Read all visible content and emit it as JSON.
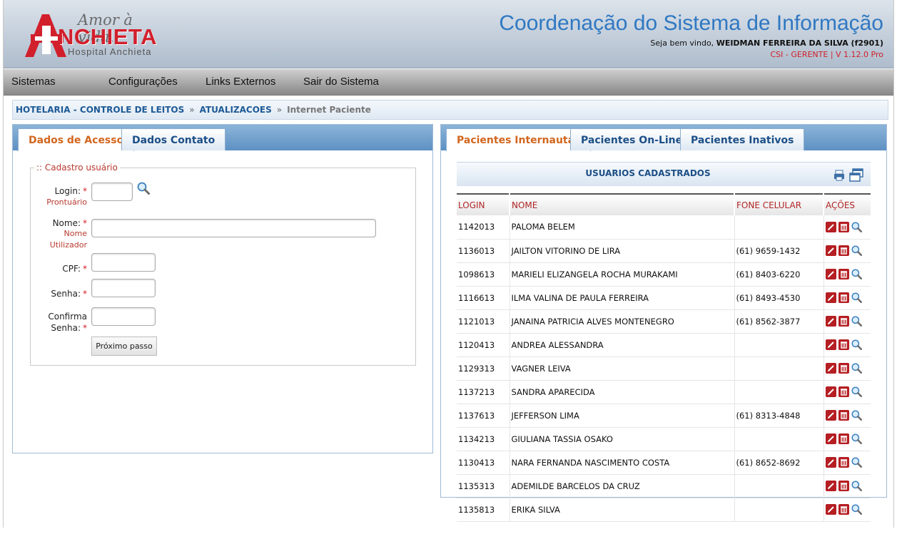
{
  "header": {
    "slogan": "Amor à vida.",
    "brand": "NCHIETA",
    "brand_sub": "Hospital Anchieta",
    "system_title": "Coordenação do Sistema de Informação",
    "welcome_prefix": "Seja bem vindo,",
    "user_name": "WEIDMAN FERREIRA DA SILVA (f2901)",
    "role_version": "CSI - GERENTE | V 1.12.0 Pro",
    "brand_color": "#d21f2c",
    "title_color": "#2f78c2"
  },
  "menu": {
    "items": [
      "Sistemas",
      "Configurações",
      "Links Externos",
      "Sair do Sistema"
    ]
  },
  "breadcrumb": {
    "items": [
      "HOTELARIA - CONTROLE DE LEITOS",
      "ATUALIZACOES"
    ],
    "separator": "»",
    "current": "Internet Paciente"
  },
  "left_tabs": [
    "Dados de Acesso",
    "Dados Contato"
  ],
  "form": {
    "legend": ":: Cadastro usuário",
    "login_label": "Login:",
    "login_hint": "Prontuário",
    "nome_label": "Nome:",
    "nome_hint_1": "Nome",
    "nome_hint_2": "Utilizador",
    "cpf_label": "CPF:",
    "senha_label": "Senha:",
    "confirma_label_1": "Confirma",
    "confirma_label_2": "Senha:",
    "required_mark": "*",
    "next_button": "Próximo passo",
    "values": {
      "login": "",
      "nome": "",
      "cpf": "",
      "senha": "",
      "confirma": ""
    }
  },
  "right_tabs": [
    "Pacientes Internautas",
    "Pacientes On-Line",
    "Pacientes Inativos"
  ],
  "list": {
    "title": "USUARIOS CADASTRADOS",
    "columns": [
      "LOGIN",
      "NOME",
      "FONE CELULAR",
      "AÇÕES"
    ],
    "rows": [
      {
        "login": "1142013",
        "nome": "PALOMA BELEM",
        "fone": ""
      },
      {
        "login": "1136013",
        "nome": "JAILTON VITORINO DE LIRA",
        "fone": "(61) 9659-1432"
      },
      {
        "login": "1098613",
        "nome": "MARIELI ELIZANGELA ROCHA MURAKAMI",
        "fone": "(61) 8403-6220"
      },
      {
        "login": "1116613",
        "nome": "ILMA VALINA DE PAULA FERREIRA",
        "fone": "(61) 8493-4530"
      },
      {
        "login": "1121013",
        "nome": "JANAINA PATRICIA ALVES MONTENEGRO",
        "fone": "(61) 8562-3877"
      },
      {
        "login": "1120413",
        "nome": "ANDREA ALESSANDRA",
        "fone": ""
      },
      {
        "login": "1129313",
        "nome": "VAGNER LEIVA",
        "fone": ""
      },
      {
        "login": "1137213",
        "nome": "SANDRA APARECIDA",
        "fone": ""
      },
      {
        "login": "1137613",
        "nome": "JEFFERSON LIMA",
        "fone": "(61) 8313-4848"
      },
      {
        "login": "1134213",
        "nome": "GIULIANA TASSIA OSAKO",
        "fone": ""
      },
      {
        "login": "1130413",
        "nome": "NARA FERNANDA NASCIMENTO COSTA",
        "fone": "(61) 8652-8692"
      },
      {
        "login": "1135313",
        "nome": "ADEMILDE BARCELOS DA CRUZ",
        "fone": ""
      },
      {
        "login": "1135813",
        "nome": "ERIKA SILVA",
        "fone": ""
      }
    ]
  },
  "icons": {
    "edit": "pencil-icon",
    "delete": "trash-icon",
    "view": "magnifier-icon",
    "print": "printer-icon",
    "window": "window-icon"
  }
}
